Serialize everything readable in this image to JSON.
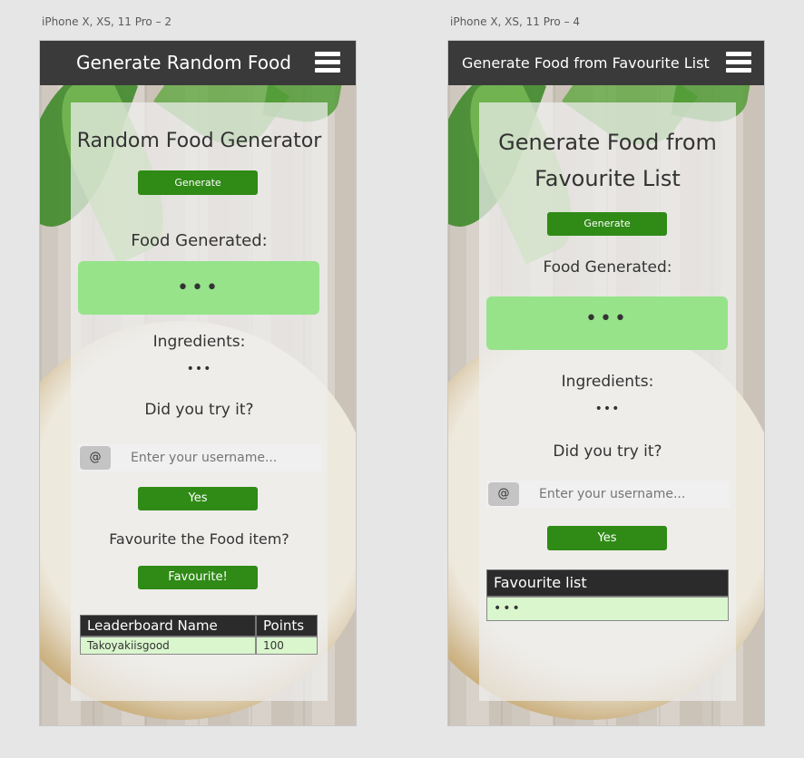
{
  "artboards": [
    {
      "label": "iPhone X, XS, 11 Pro – 2",
      "header_title": "Generate Random Food",
      "page_title": "Random Food Generator",
      "generate_label": "Generate",
      "food_generated_label": "Food Generated:",
      "food_result": "•••",
      "ingredients_label": "Ingredients:",
      "ingredients_value": "•••",
      "try_question": "Did you try it?",
      "at_symbol": "@",
      "username_placeholder": "Enter your username...",
      "yes_label": "Yes",
      "favourite_question": "Favourite the Food item?",
      "favourite_button": "Favourite!",
      "leaderboard": {
        "headers": [
          "Leaderboard Name",
          "Points"
        ],
        "rows": [
          [
            "Takoyakiisgood",
            "100"
          ]
        ]
      }
    },
    {
      "label": "iPhone X, XS, 11 Pro – 4",
      "header_title": "Generate Food from Favourite List",
      "page_title_line1": "Generate Food from",
      "page_title_line2": "Favourite List",
      "generate_label": "Generate",
      "food_generated_label": "Food Generated:",
      "food_result": "•••",
      "ingredients_label": "Ingredients:",
      "ingredients_value": "•••",
      "try_question": "Did you try it?",
      "at_symbol": "@",
      "username_placeholder": "Enter your username...",
      "yes_label": "Yes",
      "favourite_list_header": "Favourite list",
      "favourite_list_value": "•••"
    }
  ],
  "colors": {
    "header_bg": "#3a3a3a",
    "button_green": "#2f8a16",
    "result_green": "#96e38a",
    "table_row_green": "#d9f6cd"
  },
  "icons": [
    "hamburger-menu-icon"
  ]
}
